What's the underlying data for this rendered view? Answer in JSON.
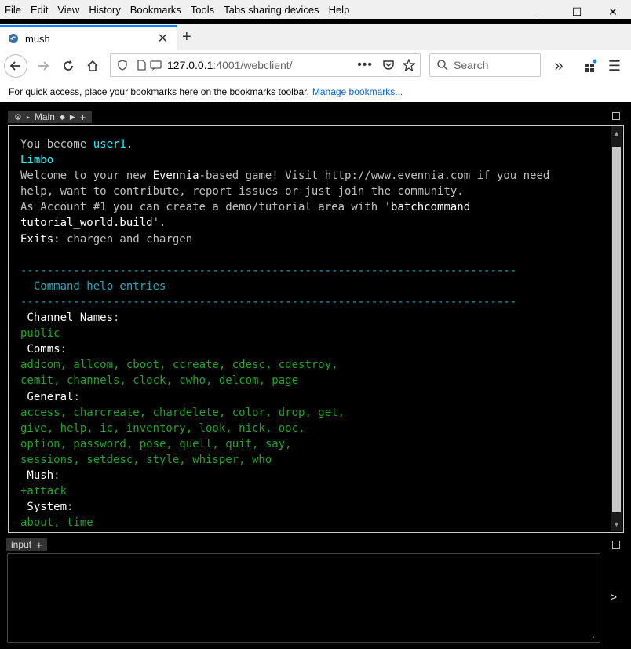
{
  "menubar": {
    "items": [
      "File",
      "Edit",
      "View",
      "History",
      "Bookmarks",
      "Tools",
      "Tabs sharing devices",
      "Help"
    ]
  },
  "window": {
    "minimize": "—",
    "maximize": "☐",
    "close": "✕"
  },
  "tabs": [
    {
      "title": "mush"
    }
  ],
  "navbar": {
    "url_host": "127.0.0.1",
    "url_rest": ":4001/webclient/",
    "search_placeholder": "Search"
  },
  "bookmarks_bar": {
    "text": "For quick access, place your bookmarks here on the bookmarks toolbar.",
    "link": "Manage bookmarks..."
  },
  "webclient": {
    "main_tab_label": "Main",
    "input_tab_label": "input",
    "send_label": ">",
    "output": {
      "line1_prefix": "You become ",
      "line1_user": "user1",
      "line1_suffix": ".",
      "room": "Limbo",
      "welcome_a": "Welcome to your new ",
      "welcome_b": "Evennia",
      "welcome_c": "-based game! Visit http://www.evennia.com if you need",
      "welcome_d": "help, want to contribute, report issues or just join the community.",
      "account_a": "As Account #1 you can create a demo/tutorial area with '",
      "account_b": "batchcommand",
      "account_c": "tutorial_world.build",
      "account_d": "'.",
      "exits_label": "Exits:",
      "exits_value": " chargen and chargen",
      "dashes": "---------------------------------------------------------------------------",
      "help_title": "  Command help entries",
      "cat1": " Channel Names",
      "cat1_items": "public",
      "cat2": " Comms",
      "cat2_line1": "addcom, allcom, cboot, ccreate, cdesc, cdestroy,",
      "cat2_line2": "cemit, channels, clock, cwho, delcom, page",
      "cat3": " General",
      "cat3_line1": "access, charcreate, chardelete, color, drop, get,",
      "cat3_line2": "give, help, ic, inventory, look, nick, ooc,",
      "cat3_line3": "option, password, pose, quell, quit, say,",
      "cat3_line4": "sessions, setdesc, style, whisper, who",
      "cat4": " Mush",
      "cat4_items": "+attack",
      "cat5": " System",
      "cat5_items": "about, time",
      "colon": ":"
    }
  }
}
